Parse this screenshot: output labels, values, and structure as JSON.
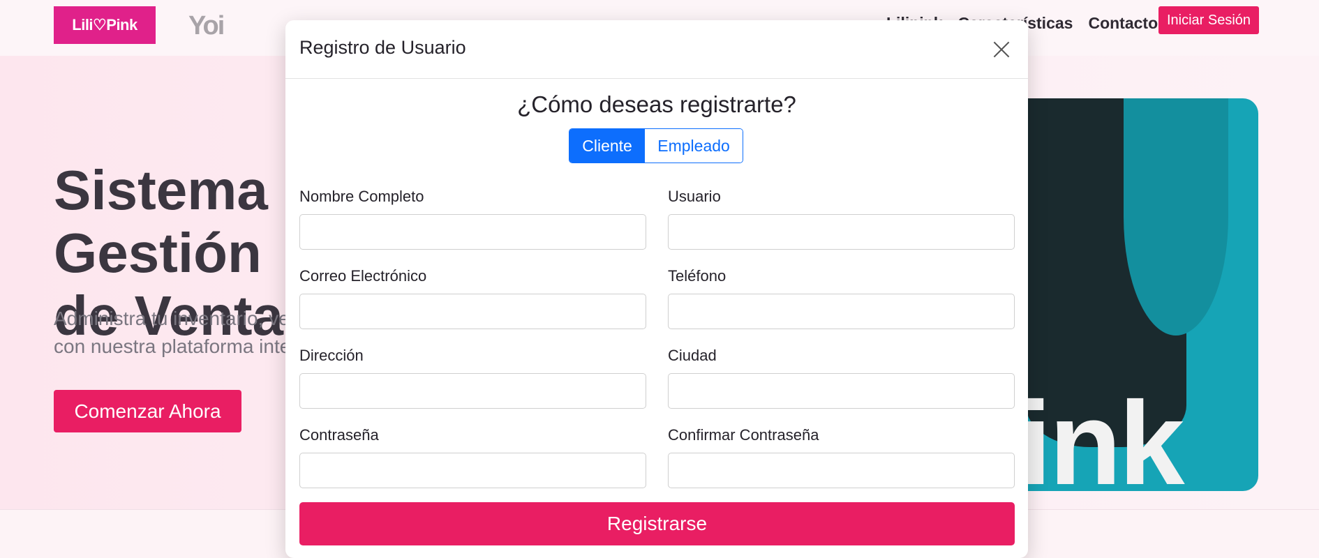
{
  "navbar": {
    "brand": "Lili♡Pink",
    "partner": "Yoi",
    "links": [
      "Lilipink",
      "Características",
      "Contacto"
    ],
    "login_label": "Iniciar Sesión"
  },
  "hero": {
    "title_line1": "Sistema de Gestión",
    "title_line2": "de Ventas",
    "subtitle_line1": "Administra tu inventario, ventas y clientes",
    "subtitle_line2": "con nuestra plataforma integral",
    "cta_label": "Comenzar Ahora",
    "image_text": "ink"
  },
  "modal": {
    "title": "Registro de Usuario",
    "question": "¿Cómo deseas registrarte?",
    "toggle": {
      "options": [
        "Cliente",
        "Empleado"
      ],
      "selected": "Cliente"
    },
    "fields": {
      "nombre": {
        "label": "Nombre Completo",
        "value": ""
      },
      "usuario": {
        "label": "Usuario",
        "value": ""
      },
      "correo": {
        "label": "Correo Electrónico",
        "value": ""
      },
      "telefono": {
        "label": "Teléfono",
        "value": ""
      },
      "direccion": {
        "label": "Dirección",
        "value": ""
      },
      "ciudad": {
        "label": "Ciudad",
        "value": ""
      },
      "contrasena": {
        "label": "Contraseña",
        "value": ""
      },
      "confirmar": {
        "label": "Confirmar Contraseña",
        "value": ""
      }
    },
    "submit_label": "Registrarse"
  },
  "colors": {
    "brand_pink": "#e91e63",
    "logo_magenta": "#e0218a",
    "primary_blue": "#0d6efd",
    "hero_teal": "#16a4b6"
  }
}
